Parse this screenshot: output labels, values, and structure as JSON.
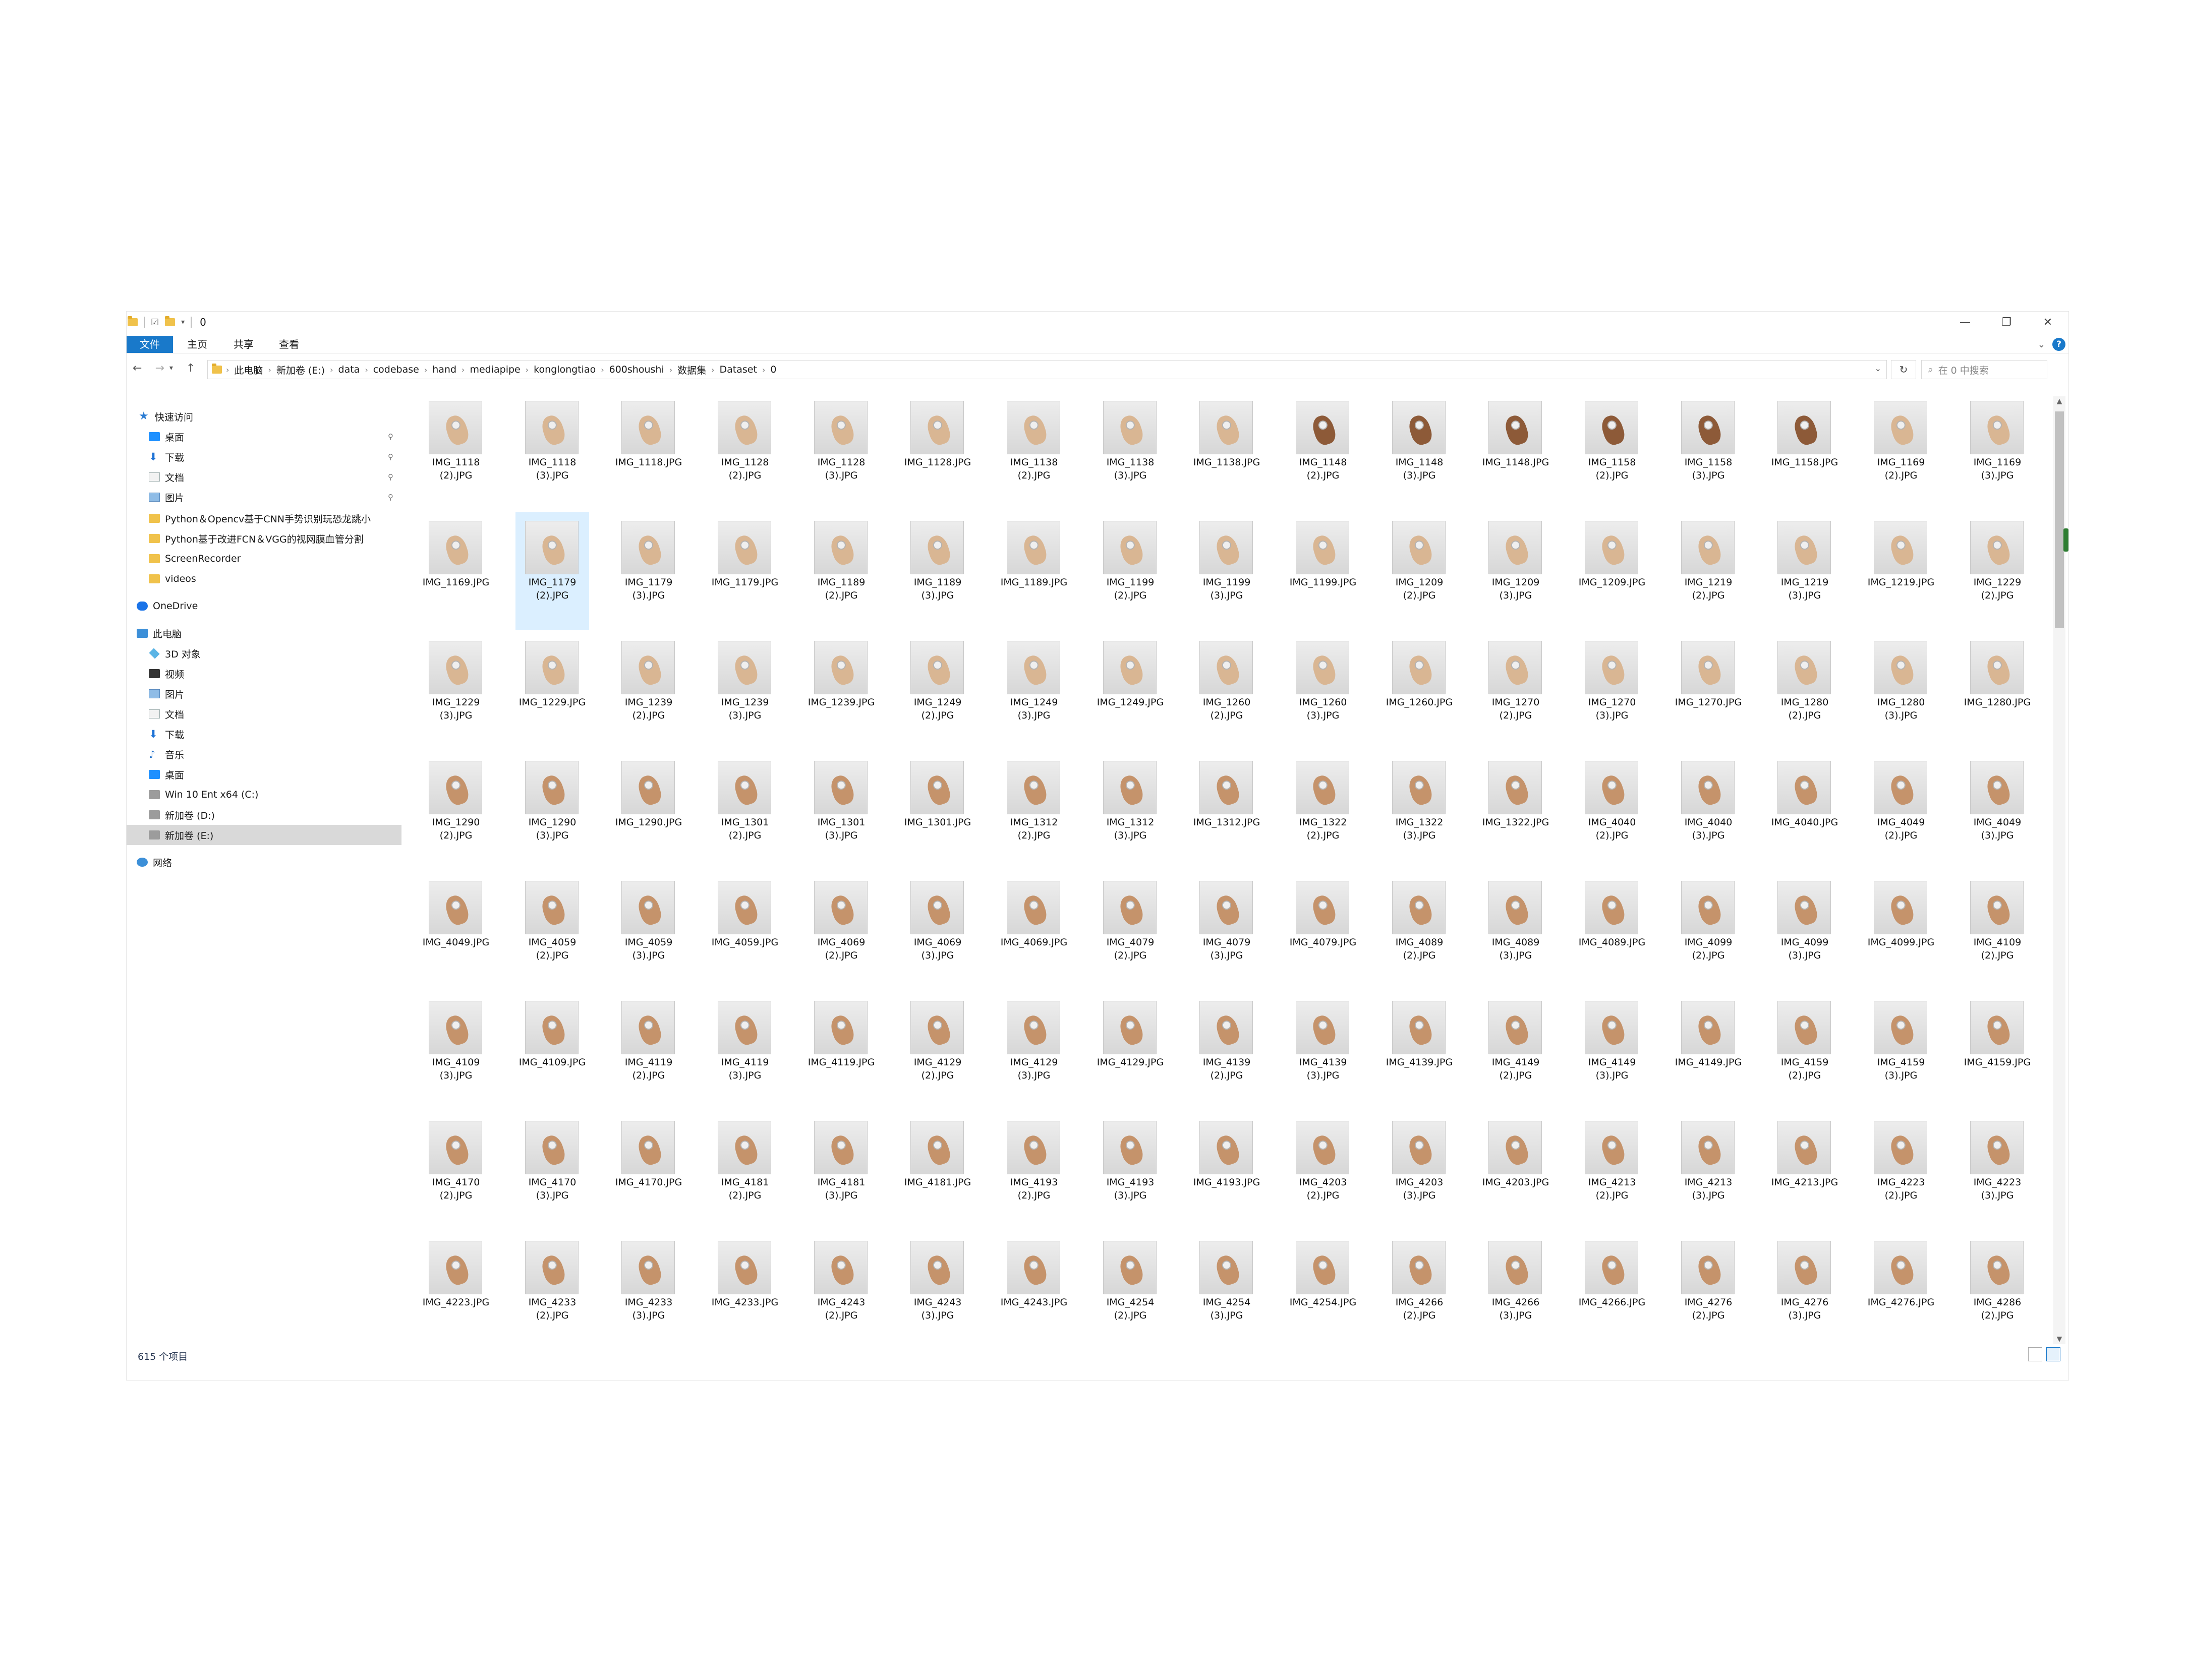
{
  "window": {
    "title": "0",
    "controls": {
      "minimize": "—",
      "restore": "❐",
      "close": "✕"
    }
  },
  "ribbon": {
    "tabs": [
      "文件",
      "主页",
      "共享",
      "查看"
    ],
    "expand_icon": "chevron-down-icon",
    "help_label": "?"
  },
  "address": {
    "crumbs": [
      "此电脑",
      "新加卷 (E:)",
      "data",
      "codebase",
      "hand",
      "mediapipe",
      "konglongtiao",
      "600shoushi",
      "数据集",
      "Dataset",
      "0"
    ],
    "search_placeholder": "在 0 中搜索"
  },
  "sidebar": {
    "items": [
      {
        "label": "快速访问",
        "icon": "star-icon",
        "pinned": false
      },
      {
        "label": "桌面",
        "icon": "desktop-icon",
        "pinned": true
      },
      {
        "label": "下载",
        "icon": "download-icon",
        "pinned": true
      },
      {
        "label": "文档",
        "icon": "document-icon",
        "pinned": true
      },
      {
        "label": "图片",
        "icon": "picture-icon",
        "pinned": true
      },
      {
        "label": "Python＆Opencv基于CNN手势识别玩恐龙跳小",
        "icon": "folder-icon",
        "pinned": false
      },
      {
        "label": "Python基于改进FCN＆VGG的视网膜血管分割",
        "icon": "folder-icon",
        "pinned": false
      },
      {
        "label": "ScreenRecorder",
        "icon": "folder-icon",
        "pinned": false
      },
      {
        "label": "videos",
        "icon": "folder-icon",
        "pinned": false
      },
      {
        "label": "OneDrive",
        "icon": "cloud-icon",
        "pinned": false
      },
      {
        "label": "此电脑",
        "icon": "computer-icon",
        "pinned": false
      },
      {
        "label": "3D 对象",
        "icon": "cube-icon",
        "pinned": false
      },
      {
        "label": "视频",
        "icon": "video-icon",
        "pinned": false
      },
      {
        "label": "图片",
        "icon": "picture-icon",
        "pinned": false
      },
      {
        "label": "文档",
        "icon": "document-icon",
        "pinned": false
      },
      {
        "label": "下载",
        "icon": "download-icon",
        "pinned": false
      },
      {
        "label": "音乐",
        "icon": "music-icon",
        "pinned": false
      },
      {
        "label": "桌面",
        "icon": "desktop-icon",
        "pinned": false
      },
      {
        "label": "Win 10 Ent x64 (C:)",
        "icon": "drive-icon",
        "pinned": false
      },
      {
        "label": "新加卷 (D:)",
        "icon": "drive-icon",
        "pinned": false
      },
      {
        "label": "新加卷 (E:)",
        "icon": "drive-icon",
        "pinned": false,
        "selected": true
      },
      {
        "label": "网络",
        "icon": "network-icon",
        "pinned": false
      }
    ],
    "pin_glyph": "📌"
  },
  "files": [
    "IMG_1118\n(2).JPG",
    "IMG_1118\n(3).JPG",
    "IMG_1118.JPG",
    "IMG_1128\n(2).JPG",
    "IMG_1128\n(3).JPG",
    "IMG_1128.JPG",
    "IMG_1138\n(2).JPG",
    "IMG_1138\n(3).JPG",
    "IMG_1138.JPG",
    "IMG_1148\n(2).JPG",
    "IMG_1148\n(3).JPG",
    "IMG_1148.JPG",
    "IMG_1158\n(2).JPG",
    "IMG_1158\n(3).JPG",
    "IMG_1158.JPG",
    "IMG_1169\n(2).JPG",
    "IMG_1169\n(3).JPG",
    "IMG_1169.JPG",
    "IMG_1179\n(2).JPG",
    "IMG_1179\n(3).JPG",
    "IMG_1179.JPG",
    "IMG_1189\n(2).JPG",
    "IMG_1189\n(3).JPG",
    "IMG_1189.JPG",
    "IMG_1199\n(2).JPG",
    "IMG_1199\n(3).JPG",
    "IMG_1199.JPG",
    "IMG_1209\n(2).JPG",
    "IMG_1209\n(3).JPG",
    "IMG_1209.JPG",
    "IMG_1219\n(2).JPG",
    "IMG_1219\n(3).JPG",
    "IMG_1219.JPG",
    "IMG_1229\n(2).JPG",
    "IMG_1229\n(3).JPG",
    "IMG_1229.JPG",
    "IMG_1239\n(2).JPG",
    "IMG_1239\n(3).JPG",
    "IMG_1239.JPG",
    "IMG_1249\n(2).JPG",
    "IMG_1249\n(3).JPG",
    "IMG_1249.JPG",
    "IMG_1260\n(2).JPG",
    "IMG_1260\n(3).JPG",
    "IMG_1260.JPG",
    "IMG_1270\n(2).JPG",
    "IMG_1270\n(3).JPG",
    "IMG_1270.JPG",
    "IMG_1280\n(2).JPG",
    "IMG_1280\n(3).JPG",
    "IMG_1280.JPG",
    "IMG_1290\n(2).JPG",
    "IMG_1290\n(3).JPG",
    "IMG_1290.JPG",
    "IMG_1301\n(2).JPG",
    "IMG_1301\n(3).JPG",
    "IMG_1301.JPG",
    "IMG_1312\n(2).JPG",
    "IMG_1312\n(3).JPG",
    "IMG_1312.JPG",
    "IMG_1322\n(2).JPG",
    "IMG_1322\n(3).JPG",
    "IMG_1322.JPG",
    "IMG_4040\n(2).JPG",
    "IMG_4040\n(3).JPG",
    "IMG_4040.JPG",
    "IMG_4049\n(2).JPG",
    "IMG_4049\n(3).JPG",
    "IMG_4049.JPG",
    "IMG_4059\n(2).JPG",
    "IMG_4059\n(3).JPG",
    "IMG_4059.JPG",
    "IMG_4069\n(2).JPG",
    "IMG_4069\n(3).JPG",
    "IMG_4069.JPG",
    "IMG_4079\n(2).JPG",
    "IMG_4079\n(3).JPG",
    "IMG_4079.JPG",
    "IMG_4089\n(2).JPG",
    "IMG_4089\n(3).JPG",
    "IMG_4089.JPG",
    "IMG_4099\n(2).JPG",
    "IMG_4099\n(3).JPG",
    "IMG_4099.JPG",
    "IMG_4109\n(2).JPG",
    "IMG_4109\n(3).JPG",
    "IMG_4109.JPG",
    "IMG_4119\n(2).JPG",
    "IMG_4119\n(3).JPG",
    "IMG_4119.JPG",
    "IMG_4129\n(2).JPG",
    "IMG_4129\n(3).JPG",
    "IMG_4129.JPG",
    "IMG_4139\n(2).JPG",
    "IMG_4139\n(3).JPG",
    "IMG_4139.JPG",
    "IMG_4149\n(2).JPG",
    "IMG_4149\n(3).JPG",
    "IMG_4149.JPG",
    "IMG_4159\n(2).JPG",
    "IMG_4159\n(3).JPG",
    "IMG_4159.JPG",
    "IMG_4170\n(2).JPG",
    "IMG_4170\n(3).JPG",
    "IMG_4170.JPG",
    "IMG_4181\n(2).JPG",
    "IMG_4181\n(3).JPG",
    "IMG_4181.JPG",
    "IMG_4193\n(2).JPG",
    "IMG_4193\n(3).JPG",
    "IMG_4193.JPG",
    "IMG_4203\n(2).JPG",
    "IMG_4203\n(3).JPG",
    "IMG_4203.JPG",
    "IMG_4213\n(2).JPG",
    "IMG_4213\n(3).JPG",
    "IMG_4213.JPG",
    "IMG_4223\n(2).JPG",
    "IMG_4223\n(3).JPG",
    "IMG_4223.JPG",
    "IMG_4233\n(2).JPG",
    "IMG_4233\n(3).JPG",
    "IMG_4233.JPG",
    "IMG_4243\n(2).JPG",
    "IMG_4243\n(3).JPG",
    "IMG_4243.JPG",
    "IMG_4254\n(2).JPG",
    "IMG_4254\n(3).JPG",
    "IMG_4254.JPG",
    "IMG_4266\n(2).JPG",
    "IMG_4266\n(3).JPG",
    "IMG_4266.JPG",
    "IMG_4276\n(2).JPG",
    "IMG_4276\n(3).JPG",
    "IMG_4276.JPG",
    "IMG_4286\n(2).JPG"
  ],
  "selected_file": "IMG_1179\n(2).JPG",
  "status": {
    "count_text": "615 个项目"
  },
  "colors": {
    "accent": "#1979ca",
    "selection": "#cce8ff",
    "sidebar_selected": "#d9d9d9"
  }
}
